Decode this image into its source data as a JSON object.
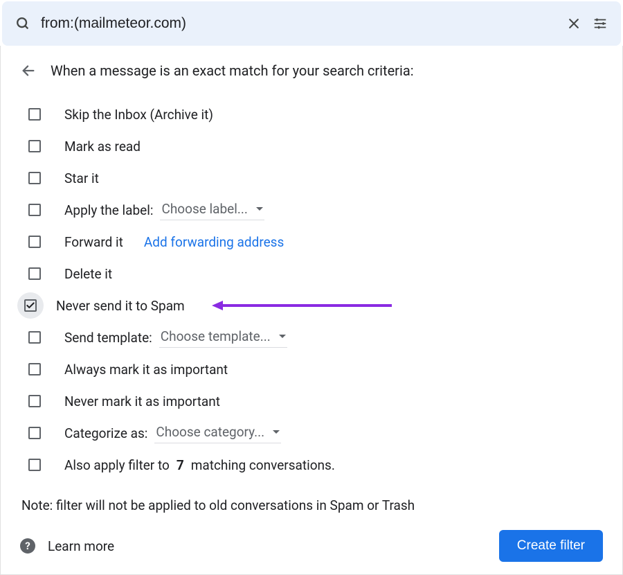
{
  "search": {
    "value": "from:(mailmeteor.com)"
  },
  "header": {
    "text": "When a message is an exact match for your search criteria:"
  },
  "options": {
    "skip_inbox": {
      "label": "Skip the Inbox (Archive it)",
      "checked": false
    },
    "mark_read": {
      "label": "Mark as read",
      "checked": false
    },
    "star": {
      "label": "Star it",
      "checked": false
    },
    "apply_label": {
      "label": "Apply the label:",
      "dropdown": "Choose label...",
      "checked": false
    },
    "forward": {
      "label": "Forward it",
      "link": "Add forwarding address",
      "checked": false
    },
    "delete": {
      "label": "Delete it",
      "checked": false
    },
    "never_spam": {
      "label": "Never send it to Spam",
      "checked": true
    },
    "send_template": {
      "label": "Send template:",
      "dropdown": "Choose template...",
      "checked": false
    },
    "always_important": {
      "label": "Always mark it as important",
      "checked": false
    },
    "never_important": {
      "label": "Never mark it as important",
      "checked": false
    },
    "categorize": {
      "label": "Categorize as:",
      "dropdown": "Choose category...",
      "checked": false
    },
    "also_apply": {
      "prefix": "Also apply filter to ",
      "count": "7",
      "suffix": " matching conversations.",
      "checked": false
    }
  },
  "note": "Note: filter will not be applied to old conversations in Spam or Trash",
  "footer": {
    "learn_more": "Learn more",
    "create_button": "Create filter"
  },
  "colors": {
    "annotation": "#8a2be2"
  }
}
